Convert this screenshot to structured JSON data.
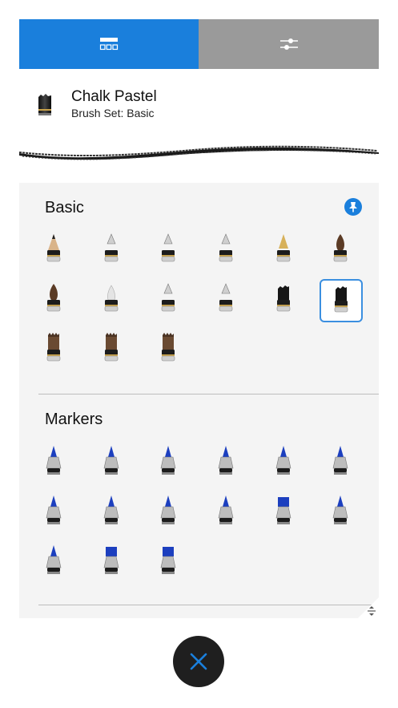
{
  "tabs": [
    {
      "id": "brush-library",
      "icon": "brush-grid-icon",
      "active": true
    },
    {
      "id": "brush-settings",
      "icon": "sliders-icon",
      "active": false
    }
  ],
  "brush": {
    "name": "Chalk Pastel",
    "set": "Brush Set: Basic",
    "thumb_icon": "chalk-pastel-icon"
  },
  "sections": [
    {
      "title": "Basic",
      "pinned": true,
      "brushes": [
        "pencil-icon",
        "ink-pen-icon",
        "technical-pen-icon",
        "ballpoint-icon",
        "fountain-pen-icon",
        "round-brush-icon",
        "flat-brush-icon",
        "blender-icon",
        "stamp-brush-icon",
        "airbrush-icon",
        "chalk-icon",
        "chalk-pastel-icon",
        "bristle-brush-icon",
        "dry-brush-icon",
        "wide-brush-icon"
      ],
      "selected_index": 11
    },
    {
      "title": "Markers",
      "pinned": false,
      "brushes": [
        "fine-marker-icon",
        "fine-marker-icon",
        "fine-marker-icon",
        "felt-marker-icon",
        "felt-marker-icon",
        "chisel-marker-icon",
        "brush-marker-icon",
        "brush-marker-icon",
        "bullet-marker-icon",
        "bullet-marker-icon",
        "block-marker-icon",
        "angled-marker-icon",
        "round-marker-icon",
        "broad-marker-icon",
        "wedge-marker-icon"
      ],
      "selected_index": -1
    }
  ],
  "colors": {
    "accent": "#1a7fdc",
    "inactive_tab": "#9a9a9a",
    "panel": "#f4f4f4",
    "close_bg": "#1f1f1f"
  }
}
